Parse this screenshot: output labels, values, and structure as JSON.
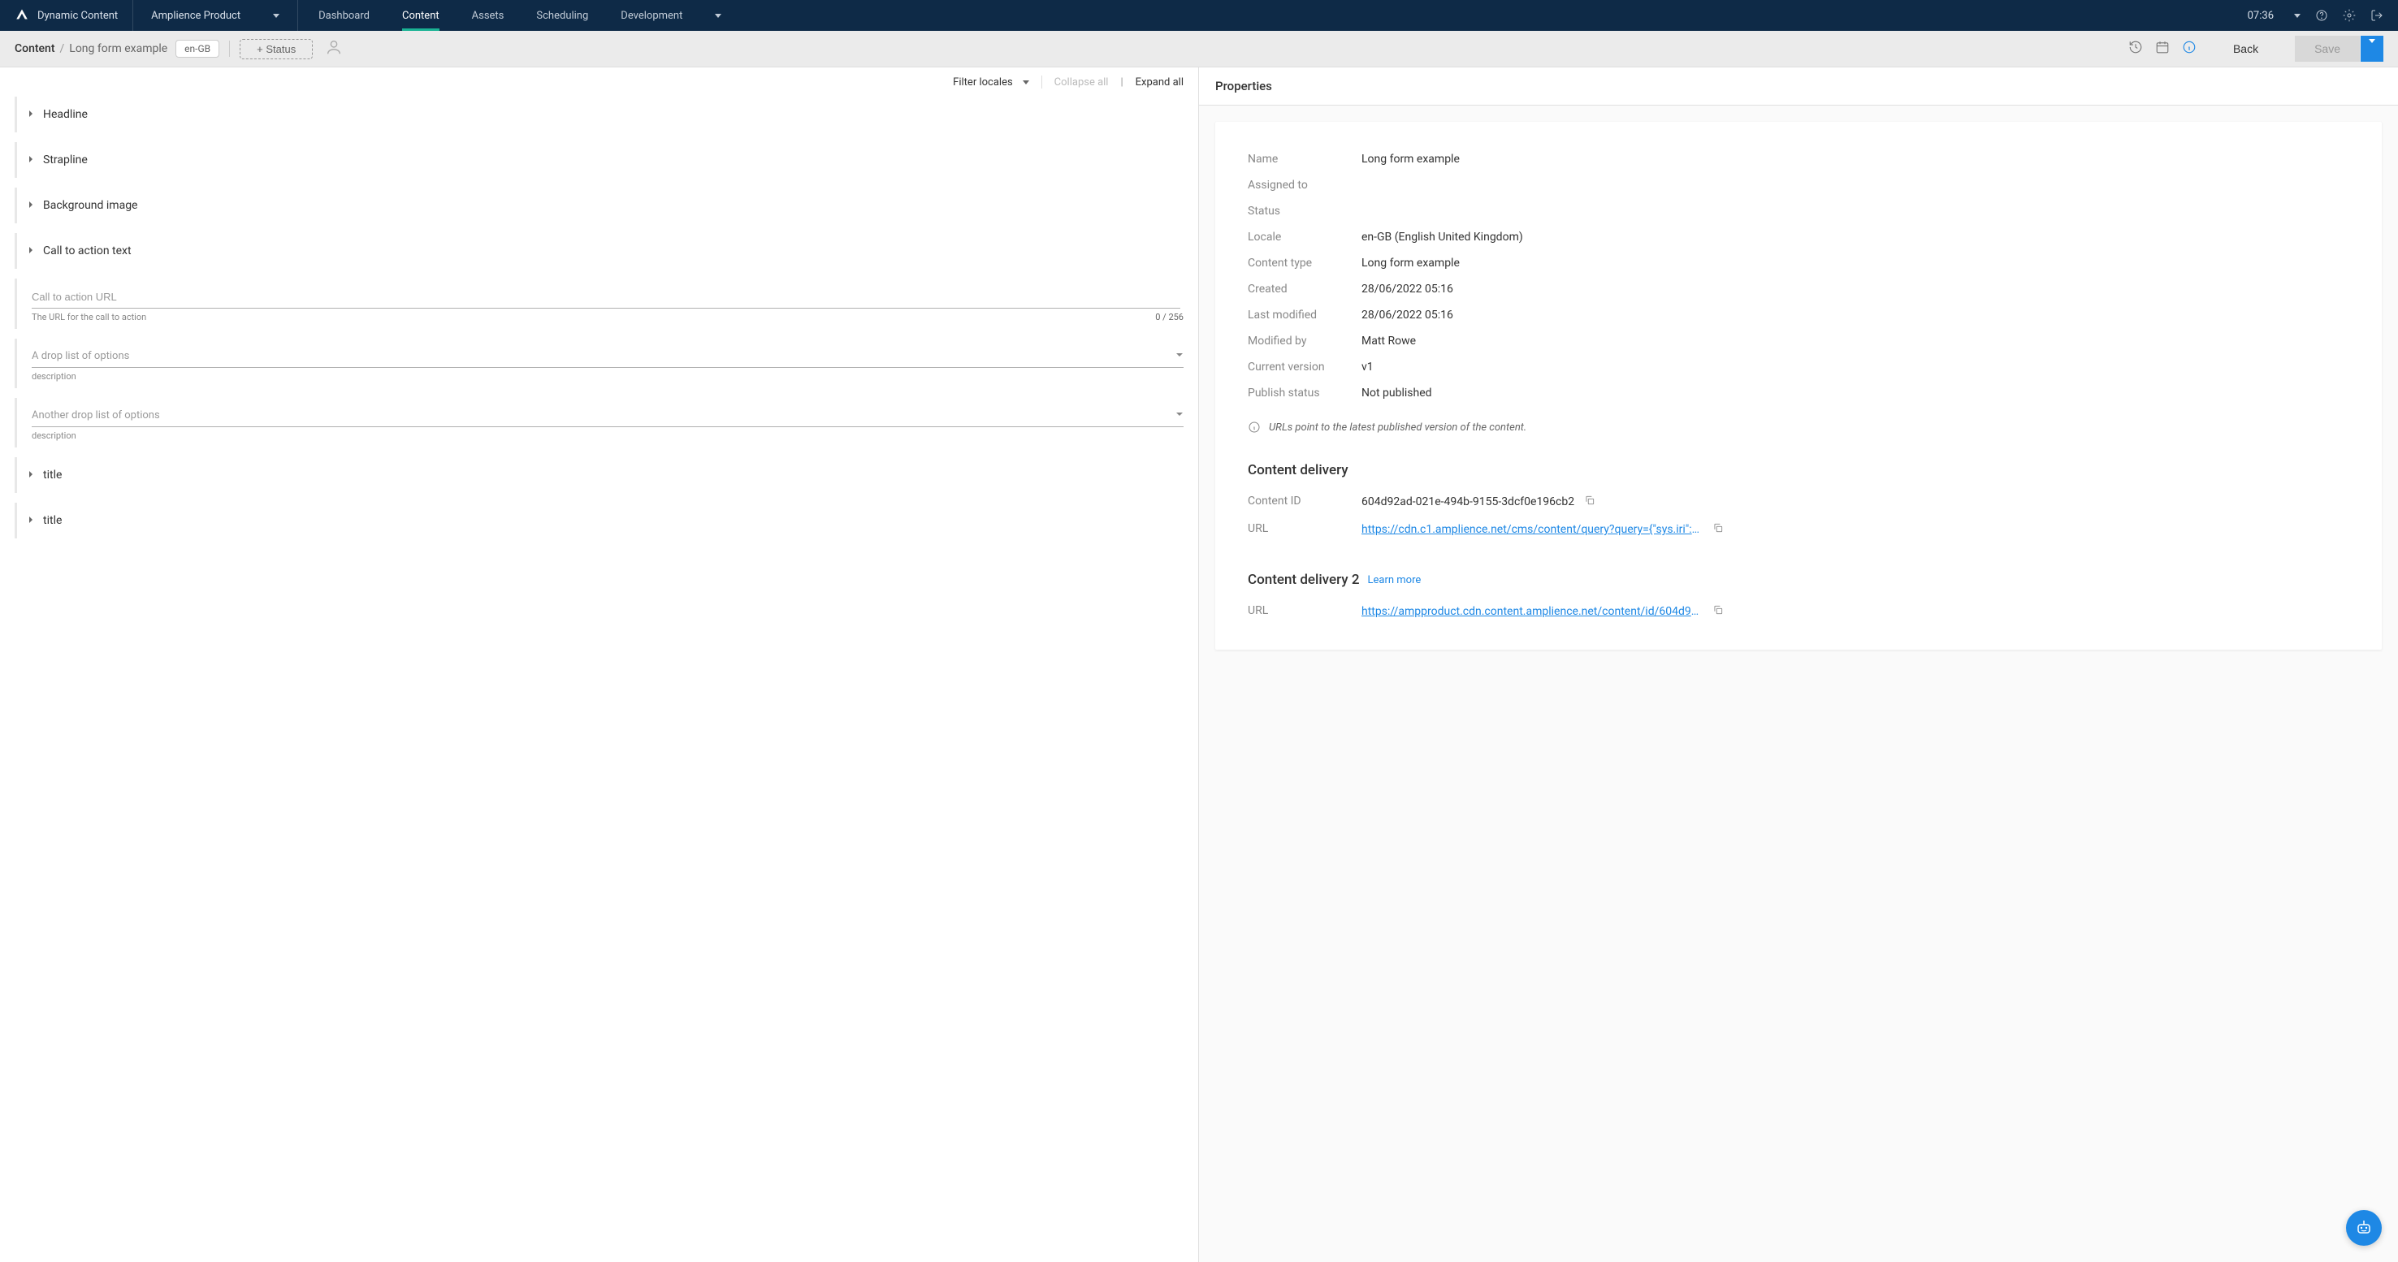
{
  "header": {
    "app_name": "Dynamic Content",
    "hub_name": "Amplience Product",
    "tabs": [
      "Dashboard",
      "Content",
      "Assets",
      "Scheduling"
    ],
    "active_tab": "Content",
    "dev_label": "Development",
    "time": "07:36"
  },
  "toolbar": {
    "breadcrumb_root": "Content",
    "breadcrumb_current": "Long form example",
    "locale_chip": "en-GB",
    "status_button": "+ Status",
    "back_label": "Back",
    "save_label": "Save"
  },
  "locale_bar": {
    "filter": "Filter locales",
    "collapse": "Collapse all",
    "expand": "Expand all"
  },
  "form": {
    "collapsible": [
      "Headline",
      "Strapline",
      "Background image",
      "Call to action text"
    ],
    "cta_url": {
      "placeholder": "Call to action URL",
      "description": "The URL for the call to action",
      "counter": "0 / 256"
    },
    "drop1": {
      "placeholder": "A drop list of options",
      "description": "description"
    },
    "drop2": {
      "placeholder": "Another drop list of options",
      "description": "description"
    },
    "titles": [
      "title",
      "title"
    ]
  },
  "properties": {
    "header": "Properties",
    "rows": [
      {
        "key": "Name",
        "val": "Long form example"
      },
      {
        "key": "Assigned to",
        "val": ""
      },
      {
        "key": "Status",
        "val": ""
      },
      {
        "key": "Locale",
        "val": "en-GB (English United Kingdom)"
      },
      {
        "key": "Content type",
        "val": "Long form example"
      },
      {
        "key": "Created",
        "val": "28/06/2022 05:16"
      },
      {
        "key": "Last modified",
        "val": "28/06/2022 05:16"
      },
      {
        "key": "Modified by",
        "val": "Matt Rowe"
      },
      {
        "key": "Current version",
        "val": "v1"
      },
      {
        "key": "Publish status",
        "val": "Not published"
      }
    ],
    "info_note": "URLs point to the latest published version of the content.",
    "delivery1_heading": "Content delivery",
    "content_id_key": "Content ID",
    "content_id_val": "604d92ad-021e-494b-9155-3dcf0e196cb2",
    "url_key": "URL",
    "url1": "https://cdn.c1.amplience.net/cms/content/query?query={\"sys.iri\":\"ht...",
    "delivery2_heading": "Content delivery 2",
    "learn_more": "Learn more",
    "url2": "https://ampproduct.cdn.content.amplience.net/content/id/604d92a..."
  }
}
